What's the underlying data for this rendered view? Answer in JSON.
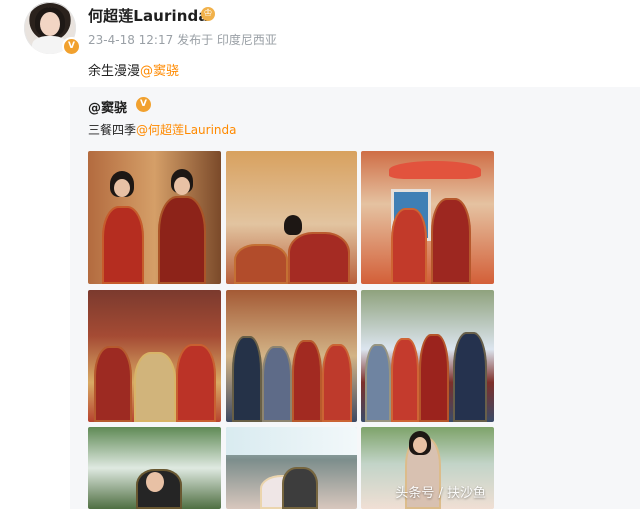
{
  "post": {
    "username": "何超莲Laurinda",
    "timestamp": "23-4-18 12:17",
    "source": "发布于 印度尼西亚",
    "text_prefix": "余生漫漫",
    "mention": "@窦骁"
  },
  "repost": {
    "author": "@窦骁",
    "text_prefix": "三餐四季",
    "mention": "@何超莲Laurinda"
  },
  "watermark": "头条号 / 扶沙鱼",
  "colors": {
    "mention": "#ff8a00",
    "badge": "#f1a12f",
    "background": "#ffffff",
    "repost_background": "#f6f7f9"
  },
  "icons": {
    "verified": "verified-badge-icon",
    "crown": "crown-icon"
  }
}
